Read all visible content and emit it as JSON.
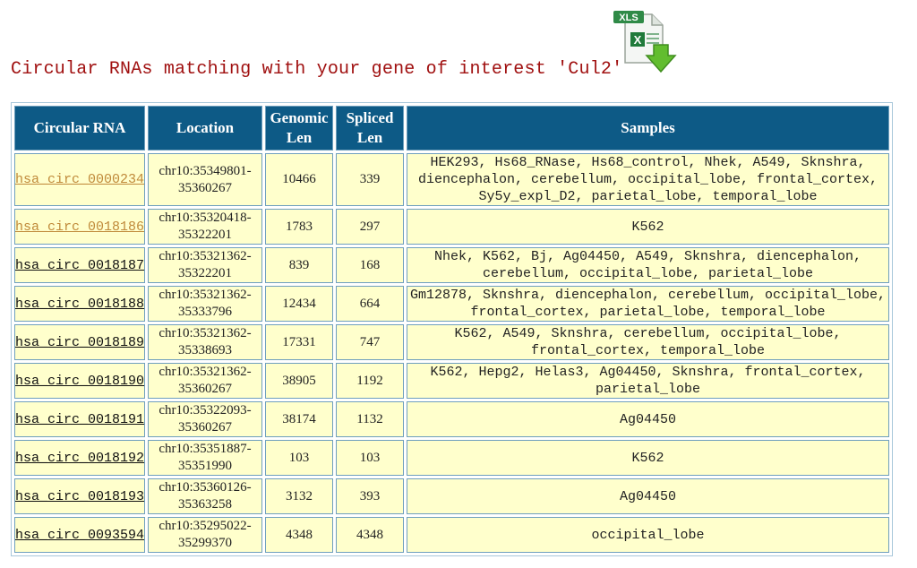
{
  "heading": "Circular RNAs matching with your gene of interest 'Cul2'",
  "download_icon": {
    "label": "XLS",
    "accent": "#1f7a3a",
    "arrow_color": "#5cb82c"
  },
  "table": {
    "headers": {
      "circ": "Circular RNA",
      "location": "Location",
      "genomic_1": "Genomic",
      "genomic_2": "Len",
      "spliced_1": "Spliced",
      "spliced_2": "Len",
      "samples": "Samples"
    },
    "rows": [
      {
        "id": "hsa_circ_0000234",
        "loc1": "chr10:35349801-",
        "loc2": "35360267",
        "genomic": "10466",
        "spliced": "339",
        "samples": "HEK293, Hs68_RNase, Hs68_control, Nhek, A549, Sknshra, diencephalon, cerebellum, occipital_lobe, frontal_cortex, Sy5y_expl_D2, parietal_lobe, temporal_lobe"
      },
      {
        "id": "hsa_circ_0018186",
        "loc1": "chr10:35320418-",
        "loc2": "35322201",
        "genomic": "1783",
        "spliced": "297",
        "samples": "K562"
      },
      {
        "id": "hsa_circ_0018187",
        "loc1": "chr10:35321362-",
        "loc2": "35322201",
        "genomic": "839",
        "spliced": "168",
        "samples": "Nhek, K562, Bj, Ag04450, A549, Sknshra, diencephalon, cerebellum, occipital_lobe, parietal_lobe"
      },
      {
        "id": "hsa_circ_0018188",
        "loc1": "chr10:35321362-",
        "loc2": "35333796",
        "genomic": "12434",
        "spliced": "664",
        "samples": "Gm12878, Sknshra, diencephalon, cerebellum, occipital_lobe, frontal_cortex, parietal_lobe, temporal_lobe"
      },
      {
        "id": "hsa_circ_0018189",
        "loc1": "chr10:35321362-",
        "loc2": "35338693",
        "genomic": "17331",
        "spliced": "747",
        "samples": "K562, A549, Sknshra, cerebellum, occipital_lobe, frontal_cortex, temporal_lobe"
      },
      {
        "id": "hsa_circ_0018190",
        "loc1": "chr10:35321362-",
        "loc2": "35360267",
        "genomic": "38905",
        "spliced": "1192",
        "samples": "K562, Hepg2, Helas3, Ag04450, Sknshra, frontal_cortex, parietal_lobe"
      },
      {
        "id": "hsa_circ_0018191",
        "loc1": "chr10:35322093-",
        "loc2": "35360267",
        "genomic": "38174",
        "spliced": "1132",
        "samples": "Ag04450"
      },
      {
        "id": "hsa_circ_0018192",
        "loc1": "chr10:35351887-",
        "loc2": "35351990",
        "genomic": "103",
        "spliced": "103",
        "samples": "K562"
      },
      {
        "id": "hsa_circ_0018193",
        "loc1": "chr10:35360126-",
        "loc2": "35363258",
        "genomic": "3132",
        "spliced": "393",
        "samples": "Ag04450"
      },
      {
        "id": "hsa_circ_0093594",
        "loc1": "chr10:35295022-",
        "loc2": "35299370",
        "genomic": "4348",
        "spliced": "4348",
        "samples": "occipital_lobe"
      }
    ]
  }
}
